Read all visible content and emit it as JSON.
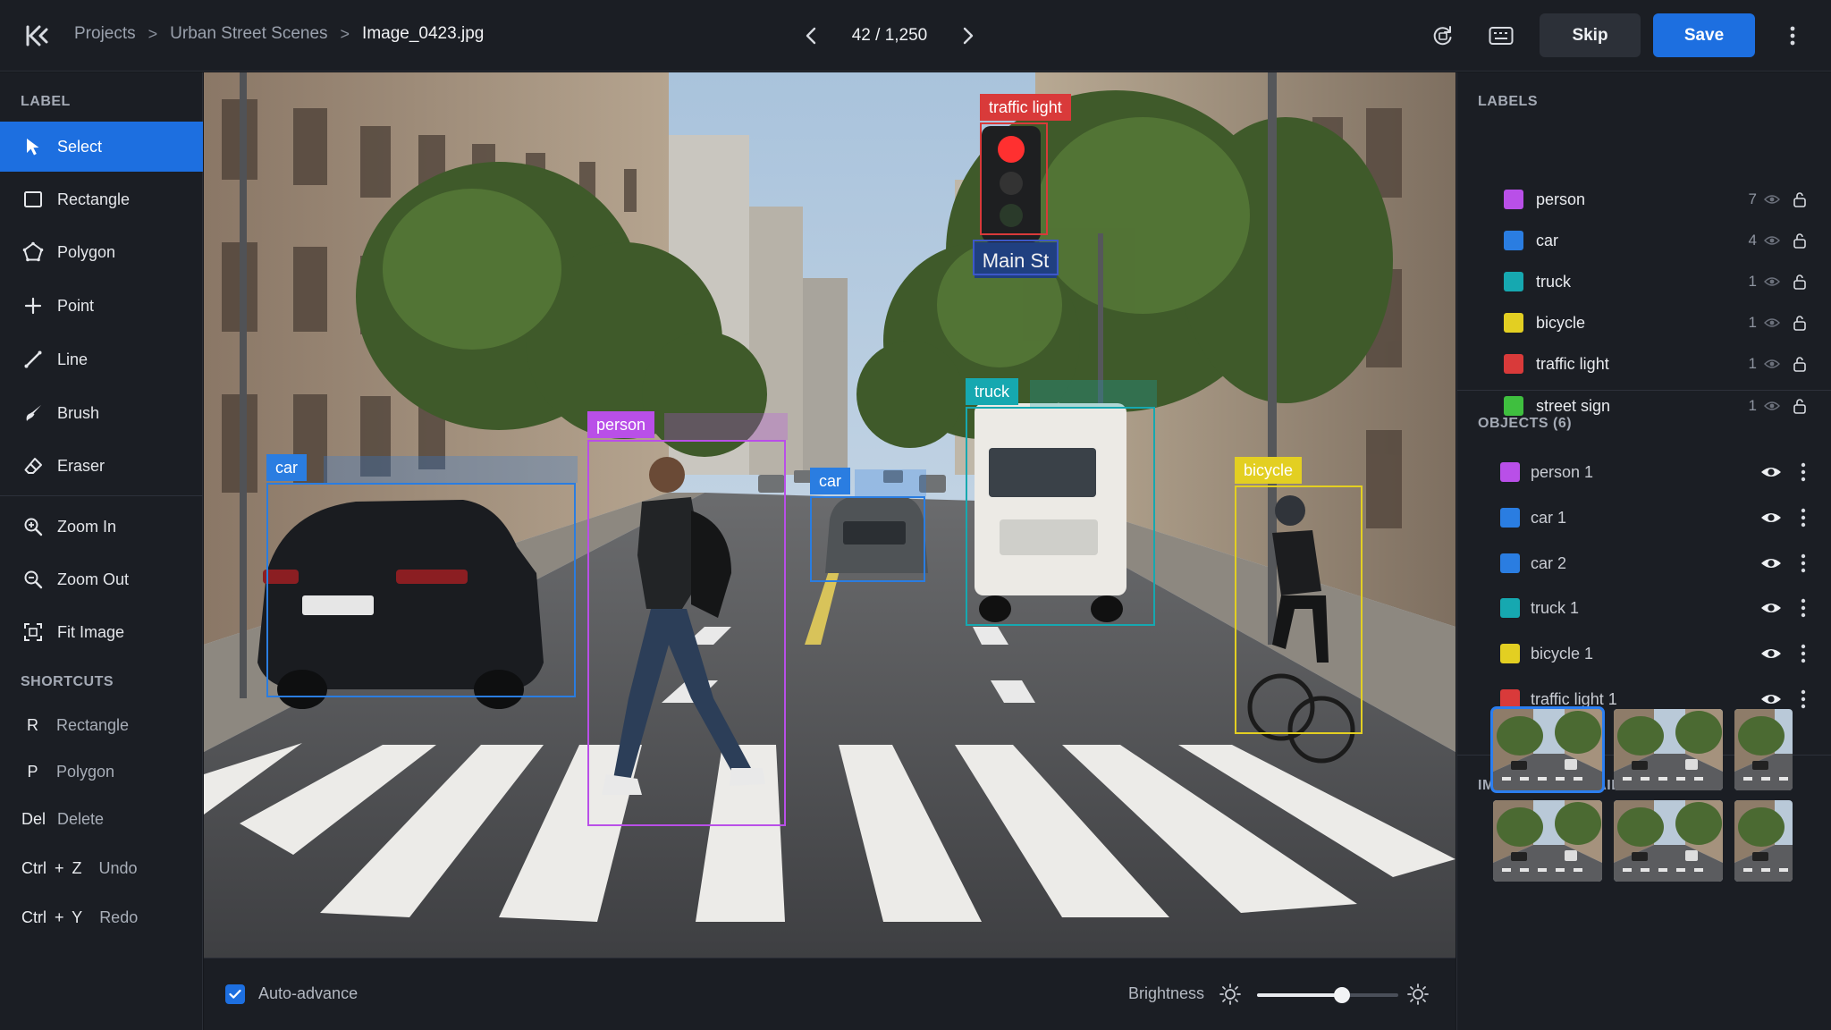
{
  "breadcrumb": {
    "projects": "Projects",
    "dataset": "Urban Street Scenes",
    "file": "Image_0423.jpg",
    "separator": ">"
  },
  "pager": {
    "position": "42 / 1,250"
  },
  "topbar": {
    "skip_label": "Skip",
    "save_label": "Save"
  },
  "sidebar": {
    "label_title": "LABEL",
    "tools": [
      {
        "label": "Select",
        "icon": "cursor-icon"
      },
      {
        "label": "Rectangle",
        "icon": "rectangle-icon"
      },
      {
        "label": "Polygon",
        "icon": "polygon-icon"
      },
      {
        "label": "Point",
        "icon": "point-icon"
      },
      {
        "label": "Line",
        "icon": "line-icon"
      },
      {
        "label": "Brush",
        "icon": "brush-icon"
      },
      {
        "label": "Eraser",
        "icon": "eraser-icon"
      }
    ],
    "view_tools": [
      {
        "label": "Zoom In",
        "icon": "zoom-in-icon"
      },
      {
        "label": "Zoom Out",
        "icon": "zoom-out-icon"
      },
      {
        "label": "Fit Image",
        "icon": "fit-image-icon"
      }
    ],
    "shortcuts_title": "SHORTCUTS",
    "shortcuts": [
      {
        "key": "R",
        "action": "Rectangle"
      },
      {
        "key": "P",
        "action": "Polygon"
      },
      {
        "key": "Del",
        "action": "Delete"
      },
      {
        "key": "Ctrl + Z",
        "action": "Undo"
      },
      {
        "key": "Ctrl + Y",
        "action": "Redo"
      }
    ]
  },
  "annotations": [
    {
      "label": "car",
      "color": "#2a7de1"
    },
    {
      "label": "person",
      "color": "#b94fe8"
    },
    {
      "label": "car",
      "color": "#2a7de1"
    },
    {
      "label": "truck",
      "color": "#16a8b0"
    },
    {
      "label": "bicycle",
      "color": "#e3cf22"
    },
    {
      "label": "traffic light",
      "color": "#d93a3a"
    },
    {
      "label": "Main St",
      "color": "#3d58c8"
    }
  ],
  "bottombar": {
    "auto_advance_label": "Auto-advance",
    "auto_advance_checked": true,
    "brightness_label": "Brightness",
    "brightness_value": 0.6
  },
  "labels_panel": {
    "title": "LABELS",
    "items": [
      {
        "name": "person",
        "count": "7",
        "color": "#b94fe8"
      },
      {
        "name": "car",
        "count": "4",
        "color": "#2a7de1"
      },
      {
        "name": "truck",
        "count": "1",
        "color": "#16a8b0"
      },
      {
        "name": "bicycle",
        "count": "1",
        "color": "#e3cf22"
      },
      {
        "name": "traffic light",
        "count": "1",
        "color": "#d93a3a"
      },
      {
        "name": "street sign",
        "count": "1",
        "color": "#3fbf3f"
      }
    ]
  },
  "objects_panel": {
    "title": "OBJECTS (6)",
    "items": [
      {
        "name": "person 1",
        "color": "#b94fe8"
      },
      {
        "name": "car 1",
        "color": "#2a7de1"
      },
      {
        "name": "car 2",
        "color": "#2a7de1"
      },
      {
        "name": "truck 1",
        "color": "#16a8b0"
      },
      {
        "name": "bicycle 1",
        "color": "#e3cf22"
      },
      {
        "name": "traffic light 1",
        "color": "#d93a3a"
      }
    ]
  },
  "thumbnails": {
    "title": "IMAGE THUMBNAILS",
    "selected_index": 0
  }
}
